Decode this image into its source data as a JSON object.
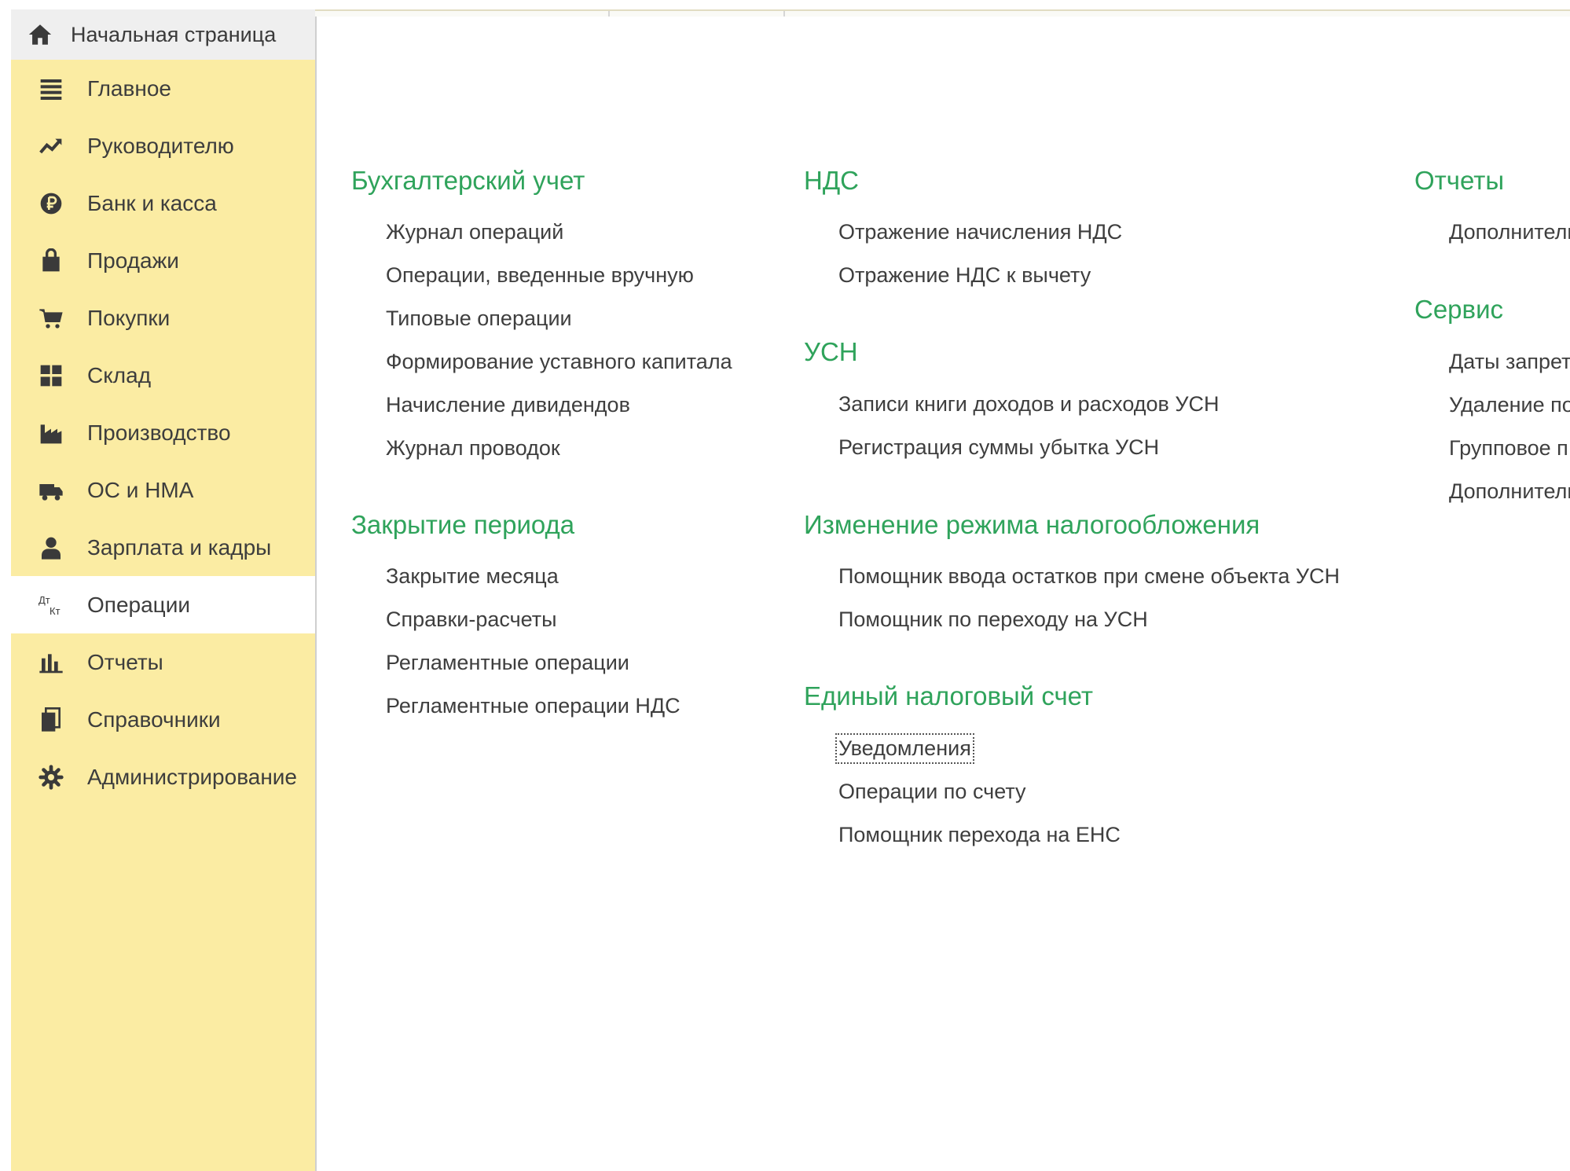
{
  "sidebar": {
    "home": {
      "label": "Начальная страница",
      "icon": "home-icon"
    },
    "items": [
      {
        "label": "Главное",
        "icon": "menu-lines-icon"
      },
      {
        "label": "Руководителю",
        "icon": "trend-chart-icon"
      },
      {
        "label": "Банк и касса",
        "icon": "ruble-coin-icon"
      },
      {
        "label": "Продажи",
        "icon": "shopping-bag-icon"
      },
      {
        "label": "Покупки",
        "icon": "cart-icon"
      },
      {
        "label": "Склад",
        "icon": "warehouse-icon"
      },
      {
        "label": "Производство",
        "icon": "factory-icon"
      },
      {
        "label": "ОС и НМА",
        "icon": "truck-icon"
      },
      {
        "label": "Зарплата и кадры",
        "icon": "person-icon"
      },
      {
        "label": "Операции",
        "icon": "dt-kt-icon",
        "active": true,
        "icon_text_top": "Дт",
        "icon_text_bottom": "Кт"
      },
      {
        "label": "Отчеты",
        "icon": "bar-chart-icon"
      },
      {
        "label": "Справочники",
        "icon": "books-icon"
      },
      {
        "label": "Администрирование",
        "icon": "gear-icon"
      }
    ]
  },
  "colors": {
    "sidebar_bg": "#fbeca3",
    "heading": "#2fa35b",
    "link": "#3e3e3e",
    "active_bg": "#ffffff",
    "home_bg": "#efefef"
  },
  "sections": {
    "accounting": {
      "title": "Бухгалтерский учет",
      "links": [
        "Журнал операций",
        "Операции, введенные вручную",
        "Типовые операции",
        "Формирование уставного капитала",
        "Начисление дивидендов",
        "Журнал проводок"
      ]
    },
    "closing": {
      "title": "Закрытие периода",
      "links": [
        "Закрытие месяца",
        "Справки-расчеты",
        "Регламентные операции",
        "Регламентные операции НДС"
      ]
    },
    "vat": {
      "title": "НДС",
      "links": [
        "Отражение начисления НДС",
        "Отражение НДС к вычету"
      ]
    },
    "usn": {
      "title": "УСН",
      "links": [
        "Записи книги доходов и расходов УСН",
        "Регистрация суммы убытка УСН"
      ]
    },
    "tax_mode": {
      "title": "Изменение режима налогообложения",
      "links": [
        "Помощник ввода остатков при смене объекта УСН",
        "Помощник по переходу на УСН"
      ]
    },
    "ens": {
      "title": "Единый налоговый счет",
      "links": [
        "Уведомления",
        "Операции по счету",
        "Помощник перехода на ЕНС"
      ]
    },
    "reports": {
      "title": "Отчеты",
      "links": [
        "Дополнительн"
      ]
    },
    "service": {
      "title": "Сервис",
      "links": [
        "Даты запрет",
        "Удаление по",
        "Групповое п",
        "Дополнительн"
      ]
    }
  }
}
